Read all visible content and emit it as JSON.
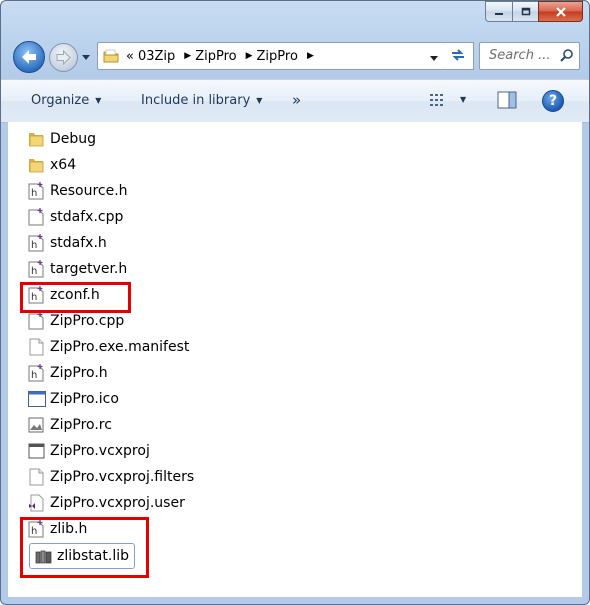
{
  "window": {
    "controls": [
      "minimize",
      "maximize",
      "close"
    ]
  },
  "address": {
    "recent_icon": "folder-icon",
    "overflow": "«",
    "crumbs": [
      "03Zip",
      "ZipPro",
      "ZipPro"
    ]
  },
  "search": {
    "placeholder": "Search ..."
  },
  "toolbar": {
    "organize": "Organize",
    "include": "Include in library",
    "more": "»"
  },
  "files": [
    {
      "name": "Debug",
      "icon": "folder-icon"
    },
    {
      "name": "x64",
      "icon": "folder-icon"
    },
    {
      "name": "Resource.h",
      "icon": "header-file-icon"
    },
    {
      "name": "stdafx.cpp",
      "icon": "cpp-file-icon"
    },
    {
      "name": "stdafx.h",
      "icon": "header-file-icon"
    },
    {
      "name": "targetver.h",
      "icon": "header-file-icon"
    },
    {
      "name": "zconf.h",
      "icon": "header-file-icon"
    },
    {
      "name": "ZipPro.cpp",
      "icon": "cpp-file-icon"
    },
    {
      "name": "ZipPro.exe.manifest",
      "icon": "blank-file-icon"
    },
    {
      "name": "ZipPro.h",
      "icon": "header-file-icon"
    },
    {
      "name": "ZipPro.ico",
      "icon": "ico-file-icon"
    },
    {
      "name": "ZipPro.rc",
      "icon": "rc-file-icon"
    },
    {
      "name": "ZipPro.vcxproj",
      "icon": "vcxproj-file-icon"
    },
    {
      "name": "ZipPro.vcxproj.filters",
      "icon": "blank-file-icon"
    },
    {
      "name": "ZipPro.vcxproj.user",
      "icon": "vs-user-file-icon"
    },
    {
      "name": "zlib.h",
      "icon": "header-file-icon"
    },
    {
      "name": "zlibstat.lib",
      "icon": "lib-file-icon"
    }
  ],
  "selected_file": "zlibstat.lib",
  "highlight_color": "#e60000"
}
